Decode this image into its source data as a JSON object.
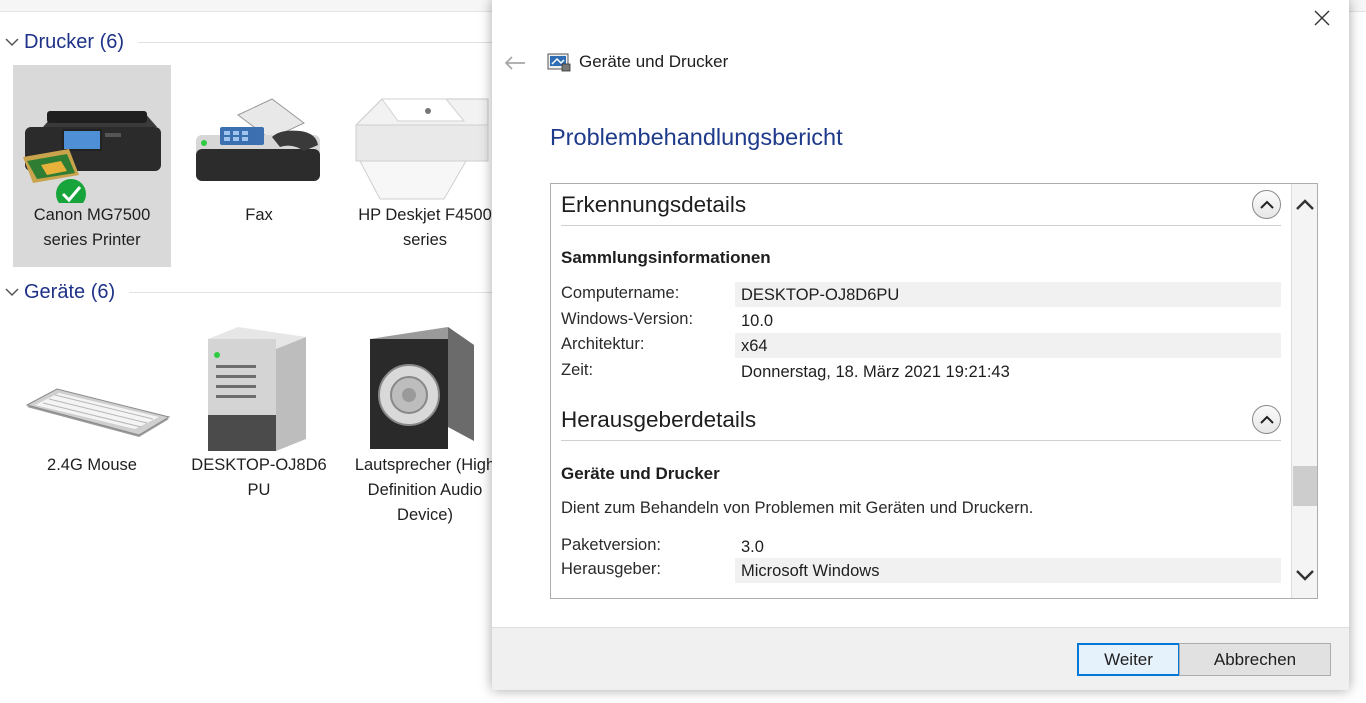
{
  "explorer": {
    "groups": [
      {
        "title": "Drucker (6)"
      },
      {
        "title": "Geräte (6)"
      }
    ],
    "printers": [
      {
        "label": "Canon MG7500 series Printer",
        "selected": true,
        "default": true
      },
      {
        "label": "Fax"
      },
      {
        "label": "HP Deskjet F4500 series"
      }
    ],
    "devices": [
      {
        "label": "2.4G Mouse"
      },
      {
        "label": "DESKTOP-OJ8D6 PU"
      },
      {
        "label": "Lautsprecher (High Definition Audio Device)"
      }
    ]
  },
  "dialog": {
    "window_title": "Geräte und Drucker",
    "heading": "Problembehandlungsbericht",
    "detection": {
      "title": "Erkennungsdetails",
      "subtitle": "Sammlungsinformationen",
      "rows": [
        {
          "key": "Computername:",
          "value": "DESKTOP-OJ8D6PU"
        },
        {
          "key": "Windows-Version:",
          "value": "10.0"
        },
        {
          "key": "Architektur:",
          "value": "x64"
        },
        {
          "key": "Zeit:",
          "value": "Donnerstag, 18. März 2021 19:21:43"
        }
      ]
    },
    "publisher": {
      "title": "Herausgeberdetails",
      "subtitle": "Geräte und Drucker",
      "description": "Dient zum Behandeln von Problemen mit Geräten und Druckern.",
      "rows": [
        {
          "key": "Paketversion:",
          "value": "3.0"
        },
        {
          "key": "Herausgeber:",
          "value": "Microsoft Windows"
        }
      ]
    },
    "buttons": {
      "next": "Weiter",
      "cancel": "Abbrechen"
    }
  },
  "colors": {
    "accent": "#0078d7",
    "heading": "#1e3a8a",
    "group_title": "#1e3287",
    "selected_tile": "#d9d9d9",
    "check_green": "#17a43a"
  },
  "icons": {
    "close": "close-icon",
    "back": "back-arrow-icon",
    "collapse": "chevron-up-icon",
    "scroll_up": "chevron-up-icon",
    "scroll_down": "chevron-down-icon"
  }
}
